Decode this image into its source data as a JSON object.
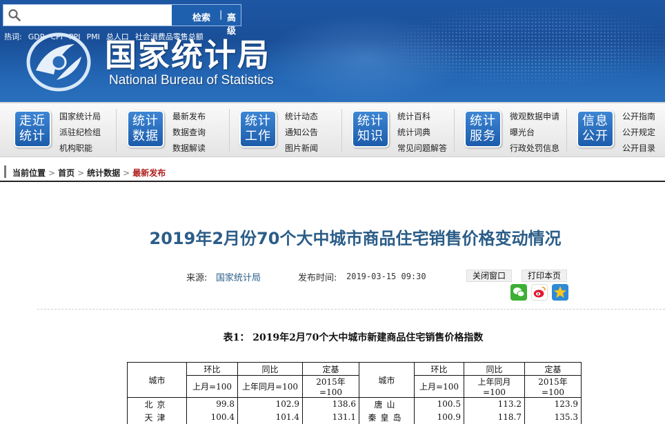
{
  "search": {
    "placeholder": "",
    "search_label": "检索",
    "separator": "|",
    "advanced_label": "高级"
  },
  "hotwords": {
    "label": "热词:",
    "items": [
      "GDP",
      "CPI",
      "PPI",
      "PMI",
      "总人口",
      "社会消费品零售总额"
    ]
  },
  "site": {
    "title": "国家统计局",
    "subtitle": "National Bureau of Statistics"
  },
  "nav": [
    {
      "badge": [
        "走近",
        "统计"
      ],
      "links": [
        "国家统计局",
        "派驻纪检组",
        "机构职能"
      ]
    },
    {
      "badge": [
        "统计",
        "数据"
      ],
      "links": [
        "最新发布",
        "数据查询",
        "数据解读"
      ]
    },
    {
      "badge": [
        "统计",
        "工作"
      ],
      "links": [
        "统计动态",
        "通知公告",
        "图片新闻"
      ]
    },
    {
      "badge": [
        "统计",
        "知识"
      ],
      "links": [
        "统计百科",
        "统计词典",
        "常见问题解答"
      ]
    },
    {
      "badge": [
        "统计",
        "服务"
      ],
      "links": [
        "微观数据申请",
        "曝光台",
        "行政处罚信息"
      ]
    },
    {
      "badge": [
        "信息",
        "公开"
      ],
      "links": [
        "公开指南",
        "公开规定",
        "公开目录"
      ]
    }
  ],
  "breadcrumb": {
    "items": [
      "当前位置",
      "首页",
      "统计数据",
      "最新发布"
    ],
    "separator": ">"
  },
  "article": {
    "title": "2019年2月份70个大中城市商品住宅销售价格变动情况",
    "source_label": "来源:",
    "source": "国家统计局",
    "time_label": "发布时间:",
    "time": "2019-03-15 09:30",
    "close_label": "关闭窗口",
    "print_label": "打印本页"
  },
  "share_icons": [
    "wechat-icon",
    "weibo-icon",
    "qzone-icon"
  ],
  "table": {
    "caption": "表1：  2019年2月70个大中城市新建商品住宅销售价格指数",
    "headers": {
      "city": "城市",
      "mom": "环比",
      "yoy": "同比",
      "fixed": "定基",
      "mom_sub": "上月=100",
      "yoy_sub": "上年同月=100",
      "fixed_sub": "2015年=100"
    },
    "rows": [
      {
        "city_l": "北京",
        "mom_l": "99.8",
        "yoy_l": "102.9",
        "fixed_l": "138.6",
        "city_r": "唐山",
        "mom_r": "100.5",
        "yoy_r": "113.2",
        "fixed_r": "123.9"
      },
      {
        "city_l": "天津",
        "mom_l": "100.4",
        "yoy_l": "101.4",
        "fixed_l": "131.1",
        "city_r": "秦皇岛",
        "mom_r": "100.9",
        "yoy_r": "118.7",
        "fixed_r": "135.3"
      }
    ]
  },
  "colors": {
    "banner": "#1d56a3",
    "title": "#2b5d88",
    "breadcrumb_current": "#b01f1f"
  }
}
